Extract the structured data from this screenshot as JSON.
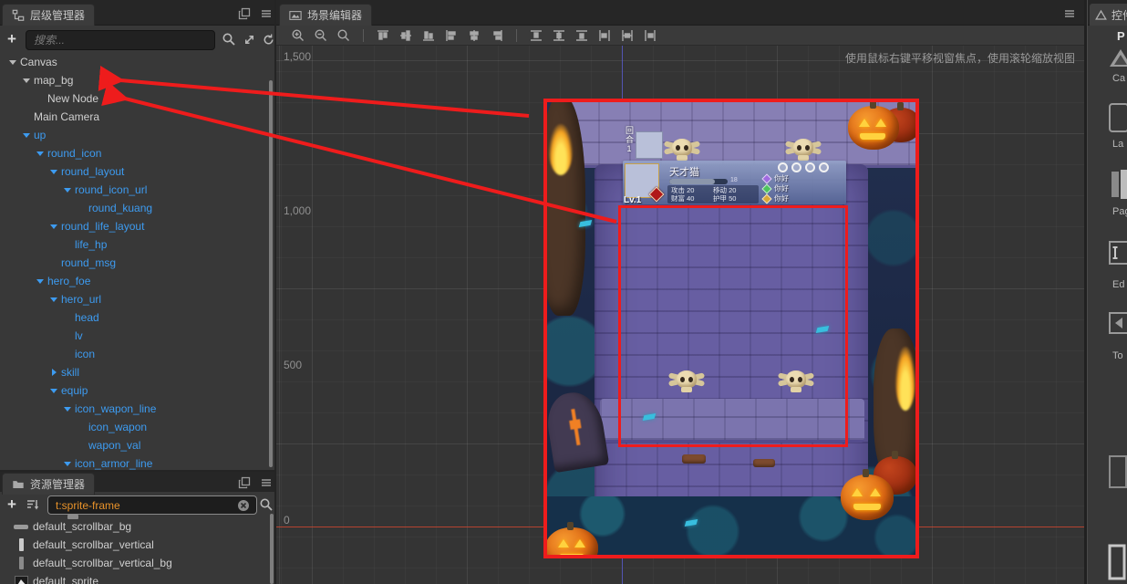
{
  "hierarchy": {
    "tab": "层级管理器",
    "search_placeholder": "搜索...",
    "tree": [
      {
        "label": "Canvas",
        "level": 0,
        "arrow": "down",
        "blue": false
      },
      {
        "label": "map_bg",
        "level": 1,
        "arrow": "down",
        "blue": false
      },
      {
        "label": "New Node",
        "level": 2,
        "arrow": "none",
        "blue": false
      },
      {
        "label": "Main Camera",
        "level": 1,
        "arrow": "none",
        "blue": false
      },
      {
        "label": "up",
        "level": 1,
        "arrow": "down",
        "blue": true
      },
      {
        "label": "round_icon",
        "level": 2,
        "arrow": "down",
        "blue": true
      },
      {
        "label": "round_layout",
        "level": 3,
        "arrow": "down",
        "blue": true
      },
      {
        "label": "round_icon_url",
        "level": 4,
        "arrow": "down",
        "blue": true
      },
      {
        "label": "round_kuang",
        "level": 5,
        "arrow": "none",
        "blue": true
      },
      {
        "label": "round_life_layout",
        "level": 3,
        "arrow": "down",
        "blue": true
      },
      {
        "label": "life_hp",
        "level": 4,
        "arrow": "none",
        "blue": true
      },
      {
        "label": "round_msg",
        "level": 3,
        "arrow": "none",
        "blue": true
      },
      {
        "label": "hero_foe",
        "level": 2,
        "arrow": "down",
        "blue": true
      },
      {
        "label": "hero_url",
        "level": 3,
        "arrow": "down",
        "blue": true
      },
      {
        "label": "head",
        "level": 4,
        "arrow": "none",
        "blue": true
      },
      {
        "label": "lv",
        "level": 4,
        "arrow": "none",
        "blue": true
      },
      {
        "label": "icon",
        "level": 4,
        "arrow": "none",
        "blue": true
      },
      {
        "label": "skill",
        "level": 3,
        "arrow": "right",
        "blue": true
      },
      {
        "label": "equip",
        "level": 3,
        "arrow": "down",
        "blue": true
      },
      {
        "label": "icon_wapon_line",
        "level": 4,
        "arrow": "down",
        "blue": true
      },
      {
        "label": "icon_wapon",
        "level": 5,
        "arrow": "none",
        "blue": true
      },
      {
        "label": "wapon_val",
        "level": 5,
        "arrow": "none",
        "blue": true
      },
      {
        "label": "icon_armor_line",
        "level": 4,
        "arrow": "down",
        "blue": true
      }
    ]
  },
  "assets": {
    "tab": "资源管理器",
    "search_value": "t:sprite-frame",
    "items": [
      {
        "name": "default_scrollbar_bg",
        "icon": "hbar"
      },
      {
        "name": "default_scrollbar_vertical",
        "icon": "vbarl"
      },
      {
        "name": "default_scrollbar_vertical_bg",
        "icon": "vbarg"
      },
      {
        "name": "default_sprite",
        "icon": "sprite"
      }
    ]
  },
  "scene": {
    "tab": "场景编辑器",
    "hint": "使用鼠标右键平移视窗焦点，使用滚轮缩放视图",
    "ruler_labels": [
      "1,500",
      "1,000",
      "500",
      "0"
    ],
    "toolbar_icons": [
      "zoom-in",
      "zoom-out",
      "zoom",
      "sep",
      "align-top",
      "align-vcenter",
      "align-bottom",
      "align-left",
      "align-hcenter",
      "align-right",
      "sep",
      "distribute-top",
      "distribute-vcenter",
      "distribute-bottom",
      "distribute-left",
      "distribute-hcenter",
      "distribute-right"
    ]
  },
  "widgets": {
    "tab": "控件",
    "header": "P",
    "items": [
      {
        "icon": "canvas-icon",
        "label": "Ca"
      },
      {
        "icon": "label-icon",
        "label": "La"
      },
      {
        "icon": "pageview-icon",
        "label": "Pag"
      },
      {
        "icon": "editbox-icon",
        "label": "Ed"
      },
      {
        "icon": "toggle-icon",
        "label": "To"
      },
      {
        "icon": "widget-icon",
        "label": ""
      },
      {
        "icon": "widget-light-icon",
        "label": ""
      }
    ]
  },
  "map": {
    "round_label": "回合1",
    "hero": {
      "name": "天才猫",
      "level": "Lv.1",
      "hp_text": "18",
      "stats": [
        {
          "k": "攻击",
          "v": "20"
        },
        {
          "k": "移动",
          "v": "20"
        },
        {
          "k": "财富",
          "v": "40"
        },
        {
          "k": "护甲",
          "v": "50"
        }
      ],
      "slots": 4,
      "equips": [
        {
          "color": "#a06ae0",
          "label": "你好"
        },
        {
          "color": "#4ec45e",
          "label": "你好"
        },
        {
          "color": "#d8a838",
          "label": "你好"
        }
      ]
    }
  },
  "colors": {
    "annotation_red": "#ee1c1c",
    "tree_blue": "#3d9bf0",
    "search_orange": "#e8922a",
    "axis_red": "#cd4630",
    "axis_blue": "#5658cd"
  }
}
